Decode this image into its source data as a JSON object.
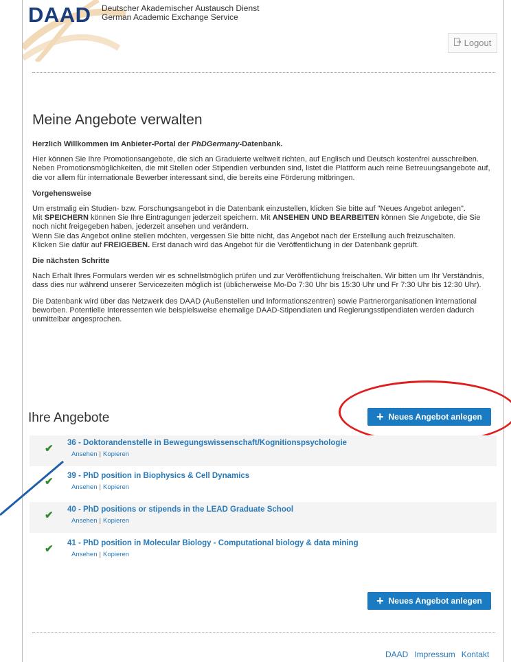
{
  "header": {
    "brand": "DAAD",
    "org_de": "Deutscher Akademischer Austausch Dienst",
    "org_en": "German Academic Exchange Service",
    "logout_label": "Logout"
  },
  "main": {
    "title": "Meine Angebote verwalten",
    "welcome_prefix": "Herzlich Willkommen im Anbieter-Portal der ",
    "welcome_brand": "PhDGermany",
    "welcome_suffix": "-Datenbank.",
    "intro_1": "Hier können Sie Ihre Promotionsangebote, die sich an Graduierte weltweit richten, auf Englisch und Deutsch kostenfrei ausschreiben.",
    "intro_2": "Neben Promotionsmöglichkeiten, die mit Stellen oder Stipendien verbunden sind, listet die Plattform auch reine Betreuungsangebote auf, die vor allem für internationale Bewerber interessant sind, die bereits eine Förderung mitbringen.",
    "procedure_heading": "Vorgehensweise",
    "procedure_1": "Um erstmalig ein Studien- bzw. Forschungsangebot in die Datenbank einzustellen, klicken Sie bitte auf \"Neues Angebot anlegen\".",
    "procedure_2a": "Mit ",
    "procedure_2_save": "SPEICHERN",
    "procedure_2b": " können Sie Ihre Eintragungen jederzeit speichern. Mit ",
    "procedure_2_view": "ANSEHEN UND BEARBEITEN",
    "procedure_2c": " können Sie Angebote, die Sie noch nicht freigegeben haben, jederzeit ansehen und verändern.",
    "procedure_3": "Wenn Sie das Angebot online stellen möchten, vergessen Sie bitte nicht, das Angebot nach der Erstellung auch freizuschalten.",
    "procedure_4a": "Klicken Sie dafür auf ",
    "procedure_4_release": "FREIGEBEN.",
    "procedure_4b": " Erst danach wird das Angebot für die Veröffentlichung in der Datenbank geprüft.",
    "next_heading": "Die nächsten Schritte",
    "next_1": "Nach Erhalt Ihres Formulars werden wir es schnellstmöglich prüfen und zur Veröffentlichung freischalten. Wir bitten um Ihr Verständnis, dass dies nur während unserer Servicezeiten möglich ist (üblicherweise Mo-Do 7:30 Uhr bis 15:30 Uhr und Fr 7:30 Uhr bis 12:30 Uhr).",
    "next_2": "Die Datenbank wird über das Netzwerk des DAAD (Außenstellen und Informationszentren) sowie Partnerorganisationen international beworben. Potentielle Interessenten wie beispielsweise ehemalige DAAD-Stipendiaten und Regierungsstipendiaten werden dadurch unmittelbar angesprochen."
  },
  "offers": {
    "heading": "Ihre Angebote",
    "new_button": "Neues Angebot anlegen",
    "view_label": "Ansehen",
    "copy_label": "Kopieren",
    "items": [
      {
        "title": "36 - Doktorandenstelle in Bewegungswissenschaft/Kognitionspsychologie"
      },
      {
        "title": "39 - PhD position in Biophysics & Cell Dynamics"
      },
      {
        "title": "40 - PhD positions or stipends in the LEAD Graduate School"
      },
      {
        "title": "41 - PhD position in Molecular Biology - Computational biology & data mining"
      }
    ]
  },
  "footer": {
    "links": [
      "DAAD",
      "Impressum",
      "Kontakt"
    ]
  },
  "colors": {
    "brand": "#1a3d7c",
    "accent": "#1b7bc2",
    "link": "#2a7ab8",
    "check": "#2e8b2e",
    "annotation_circle": "#e01e1e",
    "annotation_line": "#1d5fa8"
  },
  "icons": {
    "logout": "logout-icon",
    "check": "checkmark-icon",
    "plus": "plus-icon"
  }
}
